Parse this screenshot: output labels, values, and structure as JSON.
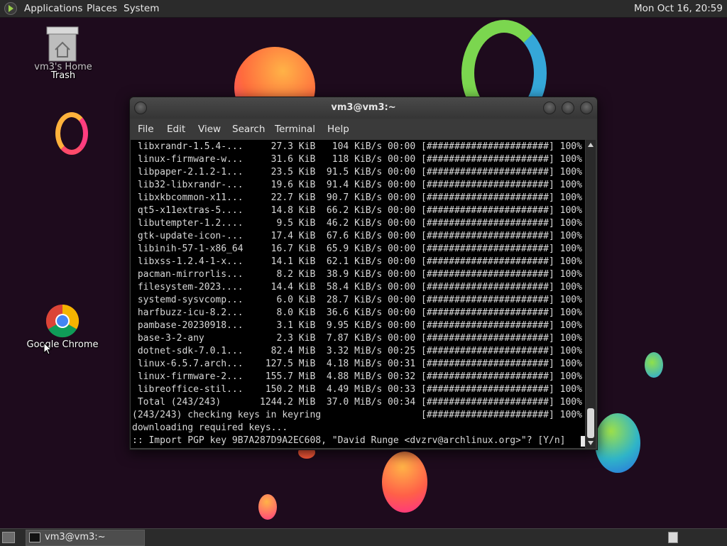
{
  "top_panel": {
    "menus": [
      "Applications",
      "Places",
      "System"
    ],
    "clock": "Mon Oct 16, 20:59"
  },
  "desktop": {
    "icons": [
      {
        "label_back": "vm3's Home",
        "label_front": "Trash"
      },
      {
        "label": "Google Chrome"
      }
    ]
  },
  "terminal": {
    "title": "vm3@vm3:~",
    "menu": [
      "File",
      "Edit",
      "View",
      "Search",
      "Terminal",
      "Help"
    ],
    "lines": [
      " libxrandr-1.5.4-...     27.3 KiB   104 KiB/s 00:00 [######################] 100%",
      " linux-firmware-w...     31.6 KiB   118 KiB/s 00:00 [######################] 100%",
      " libpaper-2.1.2-1...     23.5 KiB  91.5 KiB/s 00:00 [######################] 100%",
      " lib32-libxrandr-...     19.6 KiB  91.4 KiB/s 00:00 [######################] 100%",
      " libxkbcommon-x11...     22.7 KiB  90.7 KiB/s 00:00 [######################] 100%",
      " qt5-x11extras-5....     14.8 KiB  66.2 KiB/s 00:00 [######################] 100%",
      " libutempter-1.2....      9.5 KiB  46.2 KiB/s 00:00 [######################] 100%",
      " gtk-update-icon-...     17.4 KiB  67.6 KiB/s 00:00 [######################] 100%",
      " libinih-57-1-x86_64     16.7 KiB  65.9 KiB/s 00:00 [######################] 100%",
      " libxss-1.2.4-1-x...     14.1 KiB  62.1 KiB/s 00:00 [######################] 100%",
      " pacman-mirrorlis...      8.2 KiB  38.9 KiB/s 00:00 [######################] 100%",
      " filesystem-2023....     14.4 KiB  58.4 KiB/s 00:00 [######################] 100%",
      " systemd-sysvcomp...      6.0 KiB  28.7 KiB/s 00:00 [######################] 100%",
      " harfbuzz-icu-8.2...      8.0 KiB  36.6 KiB/s 00:00 [######################] 100%",
      " pambase-20230918...      3.1 KiB  9.95 KiB/s 00:00 [######################] 100%",
      " base-3-2-any             2.3 KiB  7.87 KiB/s 00:00 [######################] 100%",
      " dotnet-sdk-7.0.1...     82.4 MiB  3.32 MiB/s 00:25 [######################] 100%",
      " linux-6.5.7.arch...    127.5 MiB  4.18 MiB/s 00:31 [######################] 100%",
      " linux-firmware-2...    155.7 MiB  4.88 MiB/s 00:32 [######################] 100%",
      " libreoffice-stil...    150.2 MiB  4.49 MiB/s 00:33 [######################] 100%",
      " Total (243/243)       1244.2 MiB  37.0 MiB/s 00:34 [######################] 100%",
      "(243/243) checking keys in keyring                  [######################] 100%",
      "downloading required keys...",
      ":: Import PGP key 9B7A287D9A2EC608, \"David Runge <dvzrv@archlinux.org>\"? [Y/n] "
    ]
  },
  "taskbar": {
    "items": [
      {
        "label": "vm3@vm3:~"
      }
    ]
  },
  "colors": {
    "desktop_bg": "#1e0b1d",
    "panel_bg": "#2b2b2b",
    "terminal_bg": "#000000",
    "terminal_fg": "#d8d8d8"
  }
}
